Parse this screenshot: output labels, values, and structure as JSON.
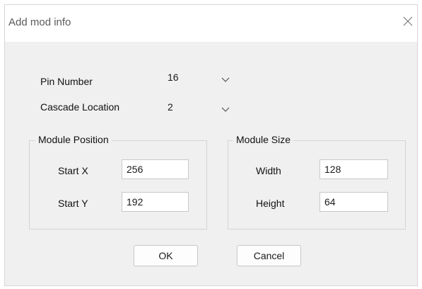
{
  "window": {
    "title": "Add mod info"
  },
  "form": {
    "pin_number": {
      "label": "Pin Number",
      "value": "16"
    },
    "cascade_location": {
      "label": "Cascade Location",
      "value": "2"
    }
  },
  "module_position": {
    "title": "Module Position",
    "start_x": {
      "label": "Start X",
      "value": "256"
    },
    "start_y": {
      "label": "Start Y",
      "value": "192"
    }
  },
  "module_size": {
    "title": "Module Size",
    "width": {
      "label": "Width",
      "value": "128"
    },
    "height": {
      "label": "Height",
      "value": "64"
    }
  },
  "buttons": {
    "ok": "OK",
    "cancel": "Cancel"
  },
  "icons": {
    "close": "close-icon",
    "dropdown": "chevron-down-icon"
  },
  "colors": {
    "dialog_bg": "#f0f0f0",
    "titlebar_bg": "#ffffff"
  }
}
